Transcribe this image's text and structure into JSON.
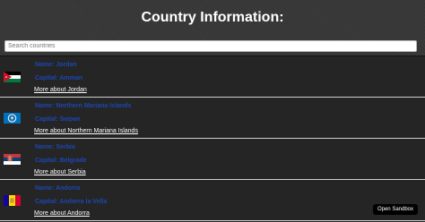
{
  "header": {
    "title": "Country Information:",
    "search_placeholder": "Search countries"
  },
  "countries": [
    {
      "name_text": "Name: Jordan",
      "capital_text": "Capital: Amman",
      "link_text": "More about Jordan",
      "flag_icon": "jordan-flag-icon"
    },
    {
      "name_text": "Name: Northern Mariana Islands",
      "capital_text": "Capital: Saipan",
      "link_text": "More about Northern Mariana Islands",
      "flag_icon": "northern-mariana-islands-flag-icon"
    },
    {
      "name_text": "Name: Serbia",
      "capital_text": "Capital: Belgrade",
      "link_text": "More about Serbia",
      "flag_icon": "serbia-flag-icon"
    },
    {
      "name_text": "Name: Andorra",
      "capital_text": "Capital: Andorra la Vella",
      "link_text": "More about Andorra",
      "flag_icon": "andorra-flag-icon"
    }
  ],
  "sandbox_button": {
    "label": "Open Sandbox"
  },
  "colors": {
    "header_bg": "#3a3a3a",
    "page_bg": "#252525",
    "name_text": "#1b47b0",
    "link_text": "#ffffff",
    "divider": "#cfcfcf"
  }
}
